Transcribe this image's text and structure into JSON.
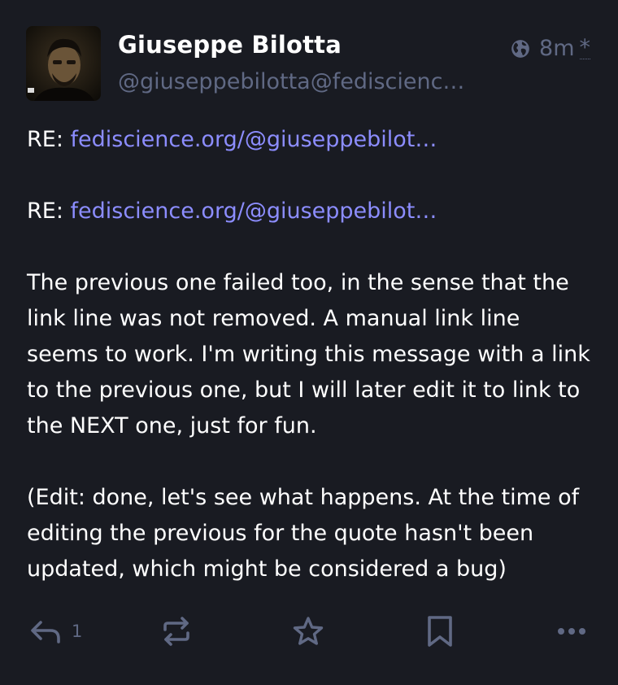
{
  "author": {
    "display_name": "Giuseppe Bilotta",
    "handle": "@giuseppebilotta@fediscienc…"
  },
  "meta": {
    "visibility_icon": "globe-icon",
    "timestamp": "8m",
    "edited_marker": "*"
  },
  "content": {
    "re1_prefix": "RE: ",
    "re1_link": "fediscience.org/@giuseppebilot…",
    "re2_prefix": "RE: ",
    "re2_link": "fediscience.org/@giuseppebilot…",
    "paragraph1": "The previous one failed too, in the sense that the link line was not removed. A manual link line seems to work. I'm writing this message with a link to the previous one, but I will later edit it to link to the NEXT one, just for fun.",
    "paragraph2": "(Edit: done, let's see what happens. At the time of editing the previous for the quote hasn't been updated, which might be considered a bug)"
  },
  "actions": {
    "reply_count": "1",
    "icons": [
      "reply-icon",
      "boost-icon",
      "favourite-icon",
      "bookmark-icon",
      "more-icon"
    ]
  },
  "colors": {
    "background": "#191b22",
    "text": "#ffffff",
    "muted": "#606984",
    "link": "#8c8dff"
  }
}
